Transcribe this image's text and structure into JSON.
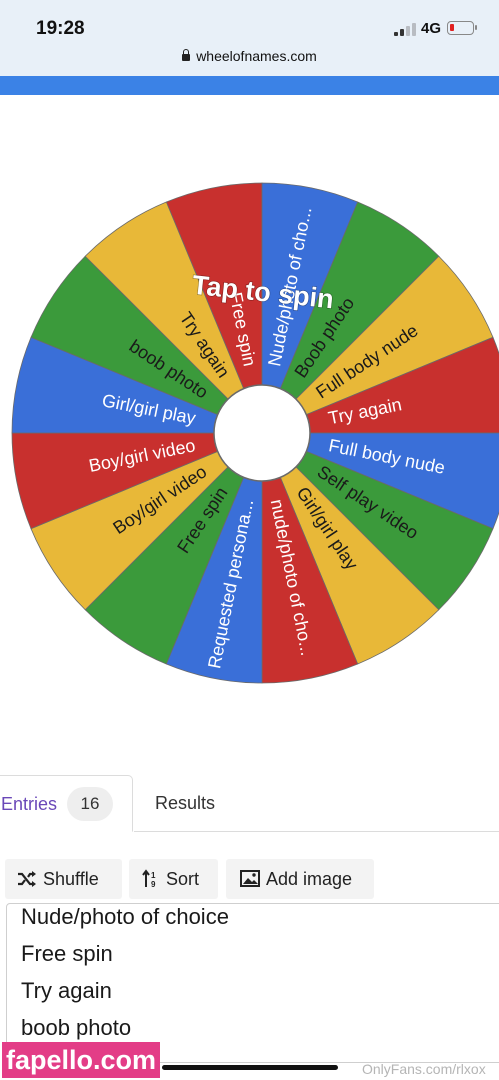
{
  "status_bar": {
    "time": "19:28",
    "network": "4G",
    "url": "wheelofnames.com",
    "battery_level": 0.1
  },
  "wheel": {
    "center_label": "Tap to spin",
    "segments": [
      {
        "label": "Free spin",
        "color": "#c8302e",
        "text_color": "#ffffff"
      },
      {
        "label": "Nude/photo of cho...",
        "color": "#3a6fd8",
        "text_color": "#ffffff"
      },
      {
        "label": "Boob photo",
        "color": "#3b9a3b",
        "text_color": "#1a1a1a"
      },
      {
        "label": "Full body nude",
        "color": "#e8b838",
        "text_color": "#1a1a1a"
      },
      {
        "label": "Try again",
        "color": "#c8302e",
        "text_color": "#ffffff"
      },
      {
        "label": "Full body nude",
        "color": "#3a6fd8",
        "text_color": "#ffffff"
      },
      {
        "label": "Self play video",
        "color": "#3b9a3b",
        "text_color": "#1a1a1a"
      },
      {
        "label": "Girl/girl play",
        "color": "#e8b838",
        "text_color": "#1a1a1a"
      },
      {
        "label": "nude/photo of cho...",
        "color": "#c8302e",
        "text_color": "#ffffff"
      },
      {
        "label": "Requested persona...",
        "color": "#3a6fd8",
        "text_color": "#ffffff"
      },
      {
        "label": "Free spin",
        "color": "#3b9a3b",
        "text_color": "#1a1a1a"
      },
      {
        "label": "Boy/girl video",
        "color": "#e8b838",
        "text_color": "#1a1a1a"
      },
      {
        "label": "Boy/girl video",
        "color": "#c8302e",
        "text_color": "#ffffff"
      },
      {
        "label": "Girl/girl play",
        "color": "#3a6fd8",
        "text_color": "#ffffff"
      },
      {
        "label": "boob photo",
        "color": "#3b9a3b",
        "text_color": "#1a1a1a"
      },
      {
        "label": "Try again",
        "color": "#e8b838",
        "text_color": "#1a1a1a"
      }
    ]
  },
  "tabs": {
    "entries_label": "Entries",
    "entries_count": "16",
    "results_label": "Results"
  },
  "toolbar": {
    "shuffle_label": "Shuffle",
    "sort_label": "Sort",
    "add_image_label": "Add image"
  },
  "entries_list": [
    "Nude/photo of choice",
    "Free spin",
    "Try again",
    "boob photo"
  ],
  "watermark": "fapello.com",
  "footer_credit": "OnlyFans.com/rlxox"
}
